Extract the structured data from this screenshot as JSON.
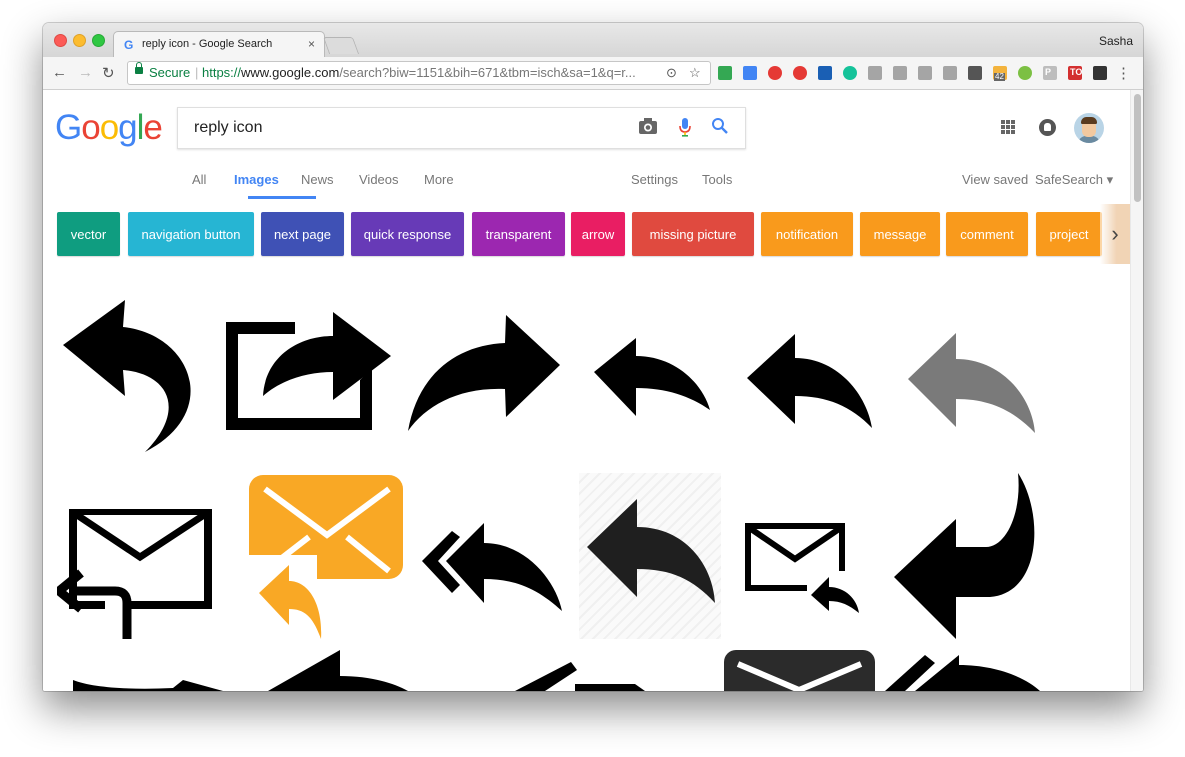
{
  "browser": {
    "tab_title": "reply icon - Google Search",
    "tab_favicon": "G",
    "tab_close": "×",
    "profile_name": "Sasha",
    "secure_label": "Secure",
    "url_protocol": "https://",
    "url_host": "www.google.com",
    "url_path": "/search?biw=1151&bih=671&tbm=isch&sa=1&q=r...",
    "back": "←",
    "forward": "→",
    "reload": "↻",
    "menu": "⋮",
    "extensions": [
      {
        "name": "extension-print-icon",
        "color": "#34a853"
      },
      {
        "name": "extension-translate-icon",
        "color": "#4285f4"
      },
      {
        "name": "extension-adblock-icon",
        "color": "#e53935"
      },
      {
        "name": "extension-opera-icon",
        "color": "#e53935"
      },
      {
        "name": "extension-analytics-icon",
        "color": "#1a5fb4"
      },
      {
        "name": "extension-grammarly-icon",
        "color": "#15c39a"
      },
      {
        "name": "extension-gray1-icon",
        "color": "#a5a5a5"
      },
      {
        "name": "extension-gray2-icon",
        "color": "#a5a5a5"
      },
      {
        "name": "extension-gray3-icon",
        "color": "#a5a5a5"
      },
      {
        "name": "extension-gray4-icon",
        "color": "#a5a5a5"
      },
      {
        "name": "extension-pocket-icon",
        "color": "#555555"
      },
      {
        "name": "extension-badge-icon",
        "color": "#f3b33d",
        "badge": "42"
      },
      {
        "name": "extension-green-dot-icon",
        "color": "#7cc043"
      },
      {
        "name": "extension-p-icon",
        "color": "#bdbdbd",
        "label": "P"
      },
      {
        "name": "extension-todo-icon",
        "color": "#d32f2f",
        "label": "TO"
      },
      {
        "name": "extension-qr-icon",
        "color": "#333333"
      }
    ]
  },
  "google": {
    "logo": [
      "G",
      "o",
      "o",
      "g",
      "l",
      "e"
    ],
    "logo_colors": [
      "#4285f4",
      "#ea4335",
      "#fbbc05",
      "#4285f4",
      "#34a853",
      "#ea4335"
    ],
    "query": "reply icon",
    "tabs": [
      "All",
      "Images",
      "News",
      "Videos",
      "More"
    ],
    "active_tab": "Images",
    "settings": "Settings",
    "tools": "Tools",
    "view_saved": "View saved",
    "safesearch": "SafeSearch",
    "safesearch_caret": "▾",
    "chips": [
      {
        "label": "vector",
        "color": "#0f9d80"
      },
      {
        "label": "navigation button",
        "color": "#26b5d3"
      },
      {
        "label": "next page",
        "color": "#3f51b5"
      },
      {
        "label": "quick response",
        "color": "#673ab7"
      },
      {
        "label": "transparent",
        "color": "#9c27b0"
      },
      {
        "label": "arrow",
        "color": "#e91e63"
      },
      {
        "label": "missing picture",
        "color": "#e04a3f"
      },
      {
        "label": "notification",
        "color": "#f99a1c"
      },
      {
        "label": "message",
        "color": "#f99a1c"
      },
      {
        "label": "comment",
        "color": "#f99a1c"
      },
      {
        "label": "project",
        "color": "#f99a1c"
      }
    ],
    "chip_next": "›"
  }
}
